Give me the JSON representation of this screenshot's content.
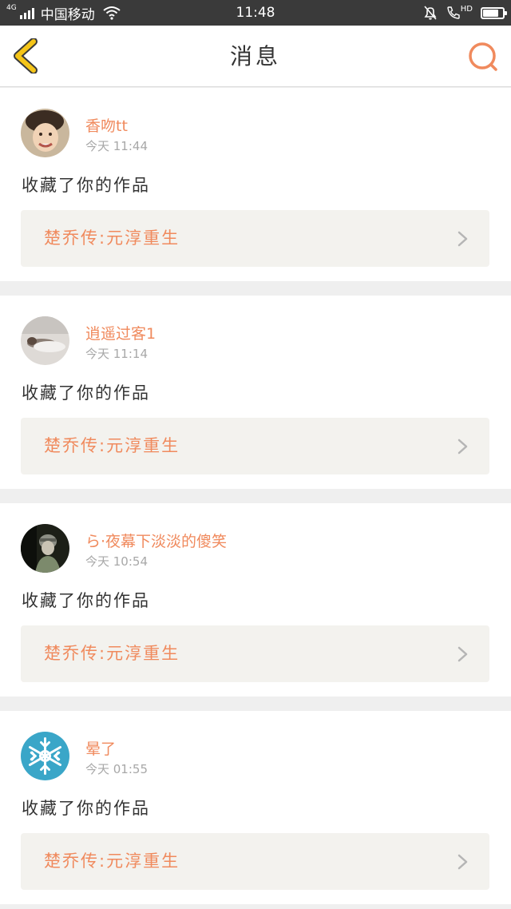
{
  "status_bar": {
    "network_type": "4G",
    "carrier": "中国移动",
    "time": "11:48",
    "hd_label": "HD",
    "battery_level": 0.85
  },
  "header": {
    "title": "消息",
    "back_icon": "chevron-left-icon",
    "search_icon": "search-icon",
    "accent_color": "#f08a5d",
    "back_color": "#f5c518"
  },
  "messages": [
    {
      "username": "香吻tt",
      "time": "今天 11:44",
      "action": "收藏了你的作品",
      "work_title": "楚乔传:元淳重生"
    },
    {
      "username": "逍遥过客1",
      "time": "今天 11:14",
      "action": "收藏了你的作品",
      "work_title": "楚乔传:元淳重生"
    },
    {
      "username": "ら·夜幕下淡淡的傻笑",
      "time": "今天 10:54",
      "action": "收藏了你的作品",
      "work_title": "楚乔传:元淳重生"
    },
    {
      "username": "晕了",
      "time": "今天 01:55",
      "action": "收藏了你的作品",
      "work_title": "楚乔传:元淳重生"
    }
  ]
}
